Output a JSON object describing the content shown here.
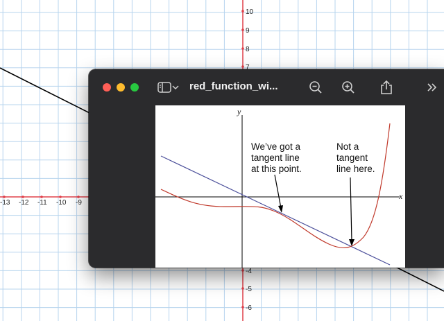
{
  "background_graph": {
    "x_tick_labels": [
      "-13",
      "-12",
      "-11",
      "-10",
      "-9"
    ],
    "y_tick_labels": [
      "10",
      "9",
      "8",
      "7",
      "-4",
      "-5",
      "-6"
    ],
    "grid_color": "#b7d4ee",
    "axis_color": "#e0404a"
  },
  "window": {
    "title": "red_function_wi...",
    "toolbar_icons": [
      "sidebar-toggle-icon",
      "chevron-down-icon",
      "zoom-out-icon",
      "zoom-in-icon",
      "share-icon",
      "more-chevrons-icon"
    ]
  },
  "document": {
    "annotation_left": [
      "We’ve got a",
      "tangent line",
      "at this point."
    ],
    "annotation_right": [
      "Not a",
      "tangent",
      "line here."
    ],
    "axis_x_label": "x",
    "axis_y_label": "y",
    "curve_color": "#c0392b",
    "tangent_color": "#4b4f9a"
  }
}
